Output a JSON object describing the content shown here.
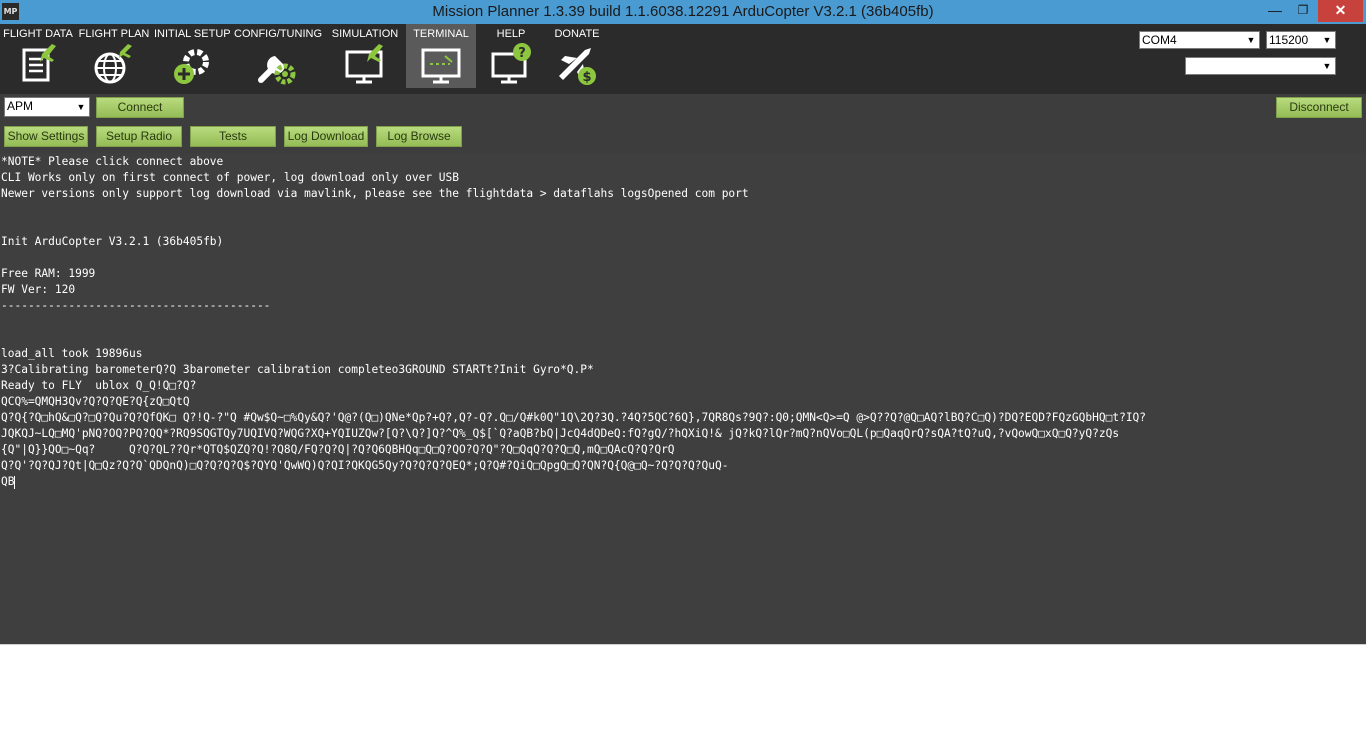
{
  "window": {
    "title": "Mission Planner 1.3.39 build 1.1.6038.12291 ArduCopter V3.2.1 (36b405fb)",
    "app_icon_text": "MP",
    "minimize": "—",
    "maximize": "❐",
    "close": "✕"
  },
  "menu": {
    "items": [
      {
        "label": "FLIGHT DATA",
        "icon": "flight-data-icon"
      },
      {
        "label": "FLIGHT PLAN",
        "icon": "flight-plan-icon"
      },
      {
        "label": "INITIAL SETUP",
        "icon": "initial-setup-icon"
      },
      {
        "label": "CONFIG/TUNING",
        "icon": "config-tuning-icon"
      },
      {
        "label": "SIMULATION",
        "icon": "simulation-icon"
      },
      {
        "label": "TERMINAL",
        "icon": "terminal-icon",
        "active": true
      },
      {
        "label": "HELP",
        "icon": "help-icon"
      },
      {
        "label": "DONATE",
        "icon": "donate-icon"
      }
    ]
  },
  "connection": {
    "port": "COM4",
    "baud": "115200",
    "third_select": ""
  },
  "toolbar": {
    "board_select": "APM",
    "connect": "Connect",
    "disconnect": "Disconnect",
    "show_settings": "Show Settings",
    "setup_radio": "Setup Radio",
    "tests": "Tests",
    "log_download": "Log Download",
    "log_browse": "Log Browse"
  },
  "terminal": {
    "text": "*NOTE* Please click connect above\nCLI Works only on first connect of power, log download only over USB\nNewer versions only support log download via mavlink, please see the flightdata > dataflahs logsOpened com port\n\n\nInit ArduCopter V3.2.1 (36b405fb)\n\nFree RAM: 1999\nFW Ver: 120\n----------------------------------------\n\n\nload_all took 19896us\n3?Calibrating barometerQ?Q 3barometer calibration completeo3GROUND STARTt?Init Gyro*Q.P*\nReady to FLY  ublox Q_Q!Q□?Q?\nQCQ%=QMQH3Qv?Q?Q?QE?Q{zQ□QtQ\nQ?Q{?Q□hQ&□Q?□Q?Qu?Q?QfQK□ Q?!Q-?\"Q #Qw$Q~□%Qy&Q?'Q@?(Q□)QNe*Qp?+Q?,Q?-Q?.Q□/Q#k0Q\"1Q\\2Q?3Q.?4Q?5QC?6Q},7QR8Qs?9Q?:Q0;QMN<Q>=Q @>Q??Q?@Q□AQ?lBQ?C□Q)?DQ?EQD?FQzGQbHQ□t?IQ?\nJQKQJ~LQ□MQ'pNQ?OQ?PQ?QQ*?RQ9SQGTQy7UQIVQ?WQG?XQ+YQIUZQw?[Q?\\Q?]Q?^Q%_Q$[`Q?aQB?bQ|JcQ4dQDeQ:fQ?gQ/?hQXiQ!& jQ?kQ?lQr?mQ?nQVo□QL(p□QaqQrQ?sQA?tQ?uQ,?vQowQ□xQ□Q?yQ?zQs\n{Q\"|Q}}QO□~Qq?     Q?Q?QL??Qr*QTQ$QZQ?Q!?Q8Q/FQ?Q?Q|?Q?Q6QBHQq□Q□Q?QO?Q?Q\"?Q□QqQ?Q?Q□Q,mQ□QAcQ?Q?QrQ\nQ?Q'?Q?QJ?Qt|Q□Qz?Q?Q`QDQnQ)□Q?Q?Q?Q$?QYQ'QwWQ)Q?QI?QKQG5Qy?Q?Q?Q?QEQ*;Q?Q#?QiQ□QpgQ□Q?QN?Q{Q@□Q~?Q?Q?Q?QuQ-\nQB"
  },
  "colors": {
    "titlebar": "#4a9bd2",
    "menubar": "#2b2b2b",
    "toolbar": "#3d3d3d",
    "terminal_bg": "#3f3f3f",
    "button_green": "#a4c96b",
    "icon_white": "#ffffff",
    "icon_green": "#8dc63f"
  }
}
